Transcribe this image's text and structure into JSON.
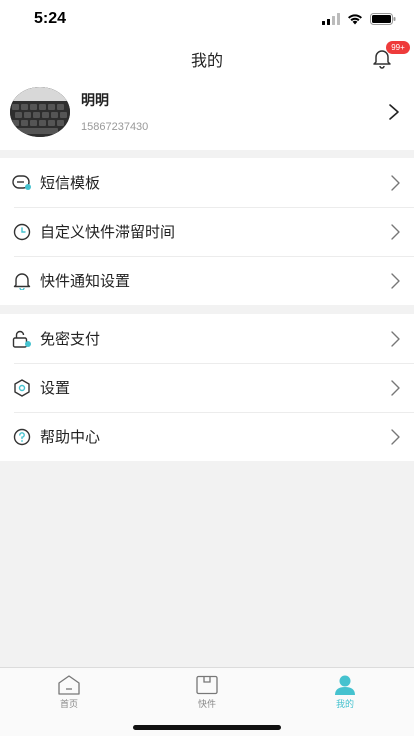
{
  "status_bar": {
    "time": "5:24"
  },
  "header": {
    "title": "我的",
    "notification_badge": "99+"
  },
  "profile": {
    "name": "明明",
    "phone": "15867237430"
  },
  "menu_groups": [
    {
      "items": [
        {
          "label": "短信模板",
          "icon": "sms-template-icon"
        },
        {
          "label": "自定义快件滞留时间",
          "icon": "clock-icon"
        },
        {
          "label": "快件通知设置",
          "icon": "bell-icon"
        }
      ]
    },
    {
      "items": [
        {
          "label": "免密支付",
          "icon": "unlock-pay-icon"
        },
        {
          "label": "设置",
          "icon": "settings-hexagon-icon"
        },
        {
          "label": "帮助中心",
          "icon": "help-icon"
        }
      ]
    }
  ],
  "tab_bar": {
    "tabs": [
      {
        "label": "首页",
        "icon": "home-icon",
        "active": false
      },
      {
        "label": "快件",
        "icon": "package-icon",
        "active": false
      },
      {
        "label": "我的",
        "icon": "user-icon",
        "active": true
      }
    ]
  },
  "colors": {
    "accent": "#45c2cf",
    "badge": "#ee3b3b",
    "background": "#f2f2f2"
  }
}
